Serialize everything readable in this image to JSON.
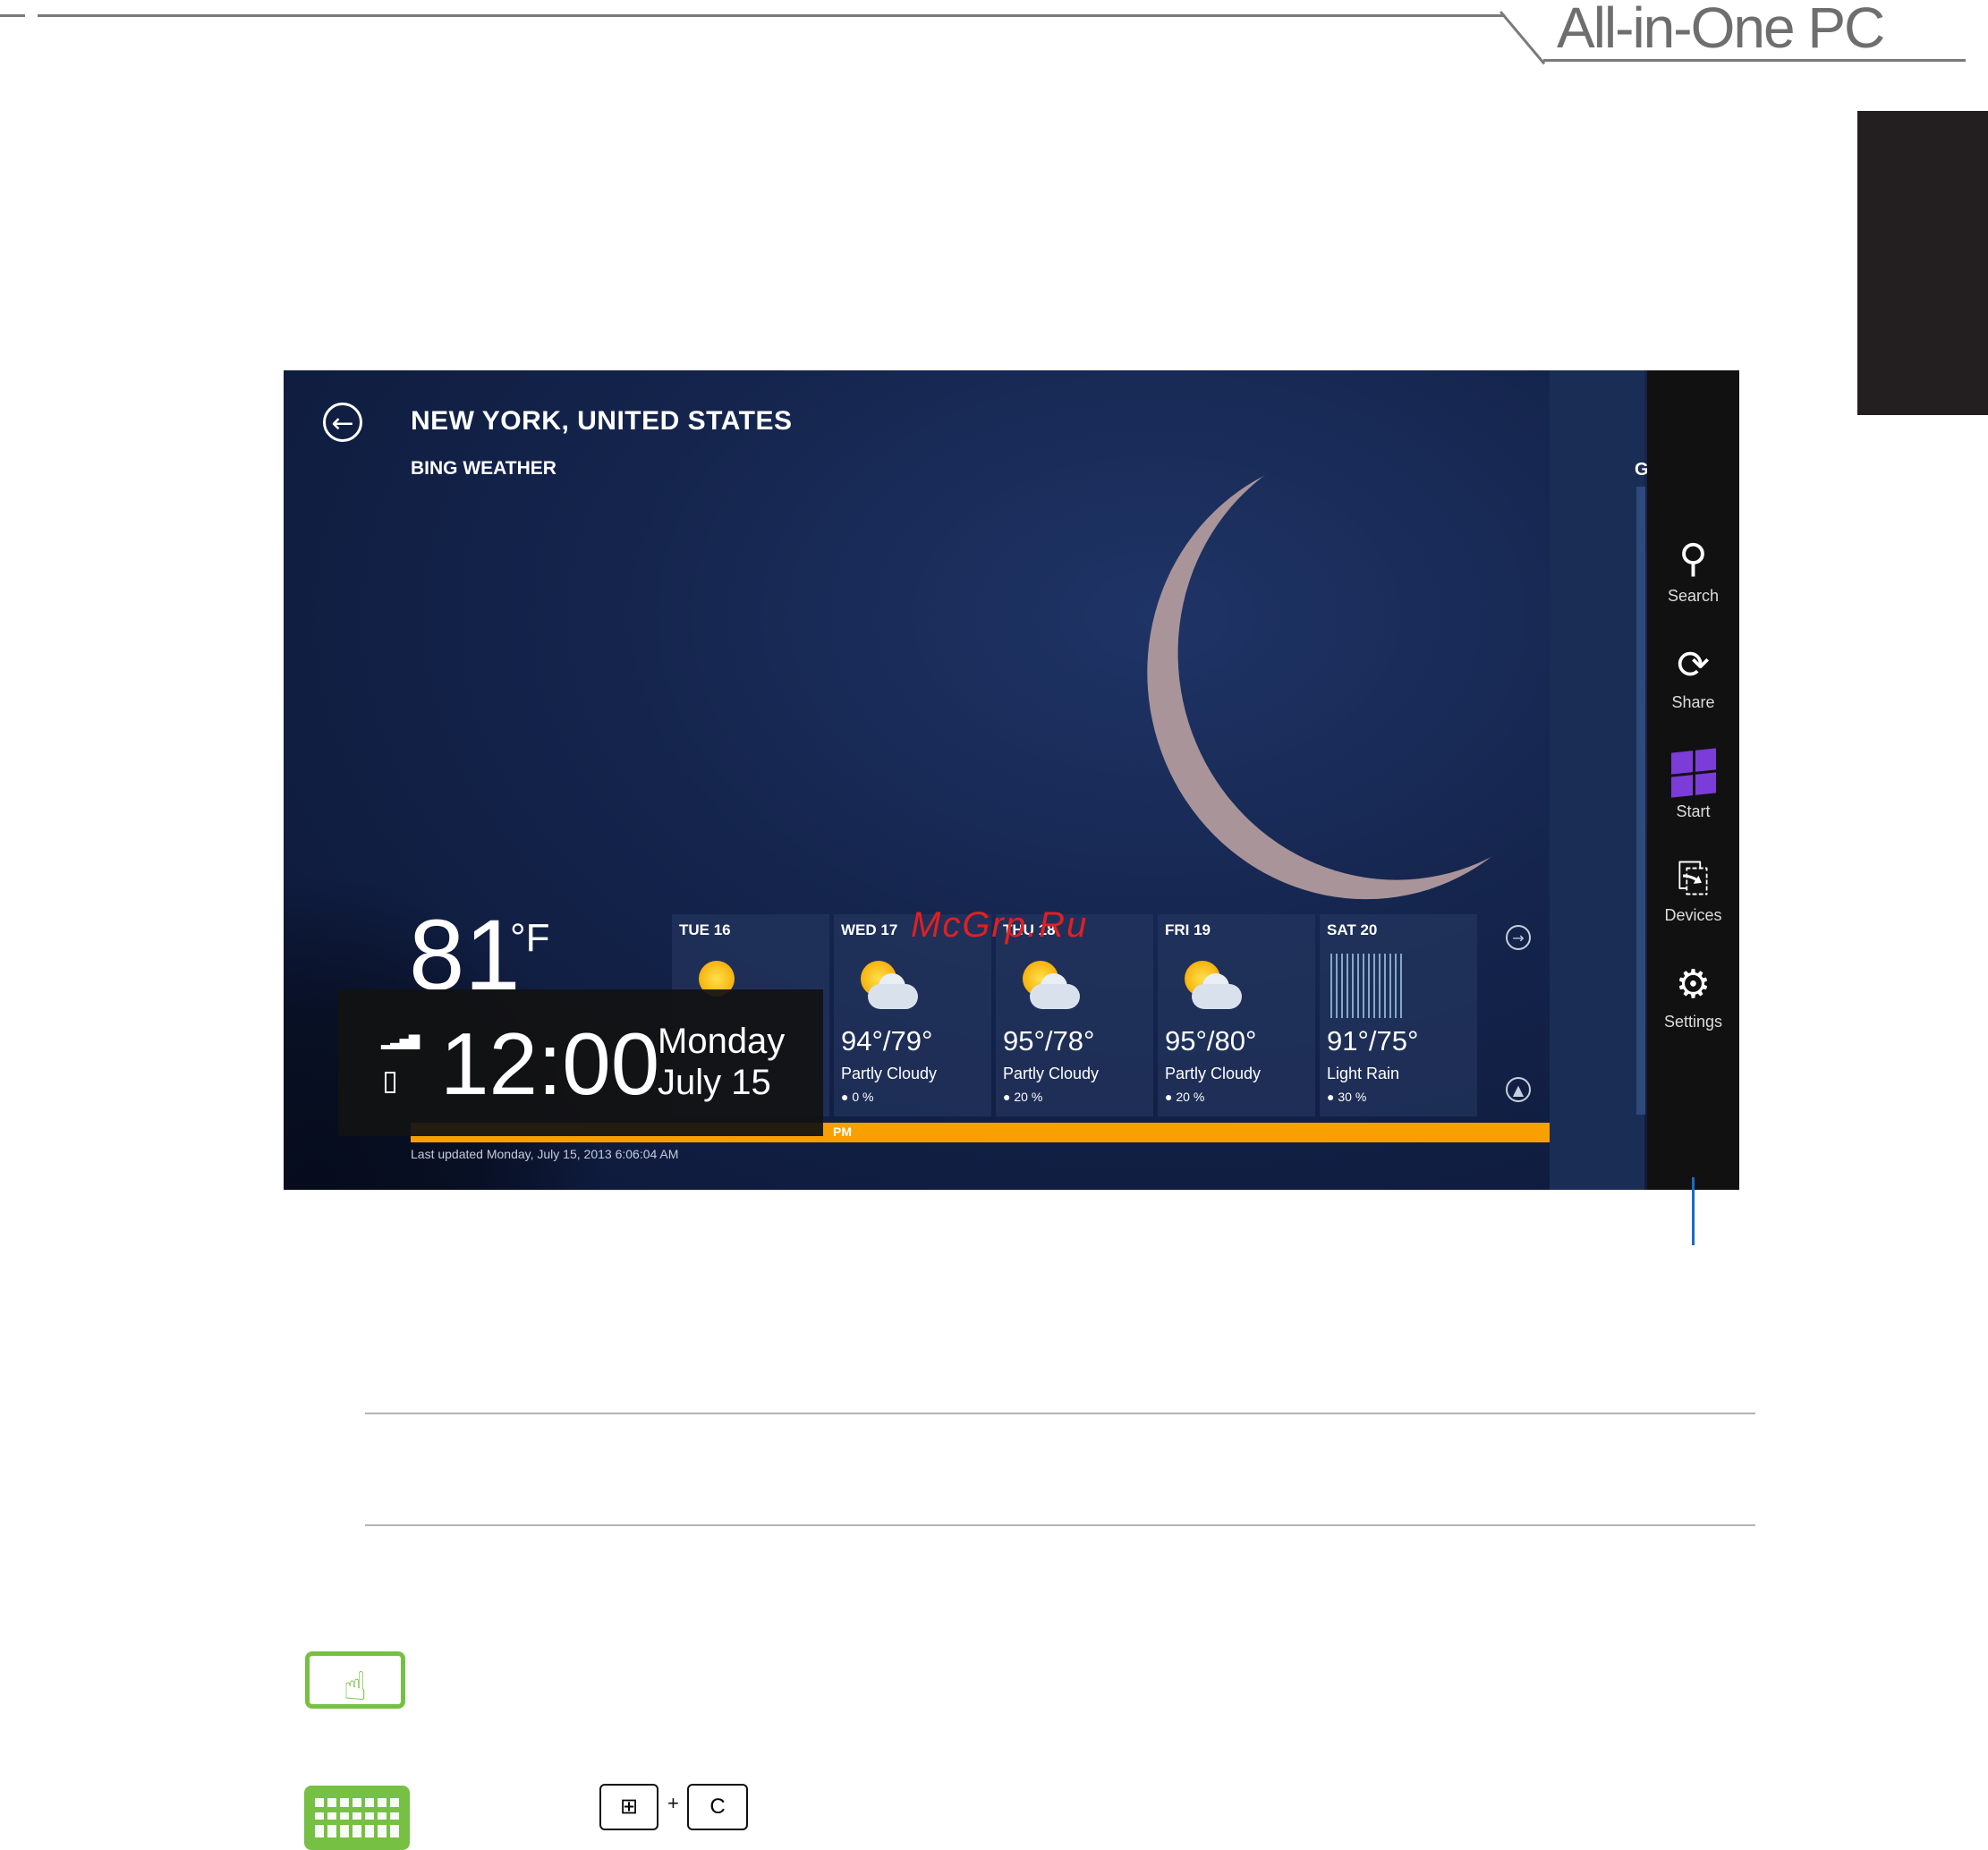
{
  "header": {
    "title": "All-in-One PC"
  },
  "weather_app": {
    "city": "NEW YORK, UNITED STATES",
    "app_name": "BING WEATHER",
    "current_temp": "81",
    "temp_unit": "°F",
    "forecast": [
      {
        "day": "TUE 16",
        "icon": "sun-icon",
        "temps": "",
        "condition": "",
        "rain": ""
      },
      {
        "day": "WED 17",
        "icon": "partly-cloudy-icon",
        "temps": "94°/79°",
        "condition": "Partly Cloudy",
        "rain": "0 %"
      },
      {
        "day": "THU 18",
        "icon": "partly-cloudy-icon",
        "temps": "95°/78°",
        "condition": "Partly Cloudy",
        "rain": "20 %"
      },
      {
        "day": "FRI 19",
        "icon": "partly-cloudy-icon",
        "temps": "95°/80°",
        "condition": "Partly Cloudy",
        "rain": "20 %"
      },
      {
        "day": "SAT 20",
        "icon": "light-rain-icon",
        "temps": "91°/75°",
        "condition": "Light Rain",
        "rain": "30 %"
      }
    ],
    "alert_suffix": "PM",
    "last_updated": "Last updated Monday, July 15, 2013 6:06:04 AM",
    "right_panel_letter": "G"
  },
  "clock": {
    "time": "12:00",
    "day": "Monday",
    "date": "July 15"
  },
  "charms": [
    {
      "label": "Search",
      "icon": "search-icon"
    },
    {
      "label": "Share",
      "icon": "share-icon"
    },
    {
      "label": "Start",
      "icon": "windows-logo-icon"
    },
    {
      "label": "Devices",
      "icon": "devices-icon"
    },
    {
      "label": "Settings",
      "icon": "gear-icon"
    }
  ],
  "watermark": "McGrp.Ru",
  "keyboard_shortcut": {
    "key1": "windows-key-icon",
    "plus": "+",
    "key2": "C"
  },
  "colors": {
    "accent_orange": "#f7a000",
    "start_purple": "#7c3cd8",
    "touch_green": "#76c043",
    "callout_blue": "#1a6bc4"
  }
}
